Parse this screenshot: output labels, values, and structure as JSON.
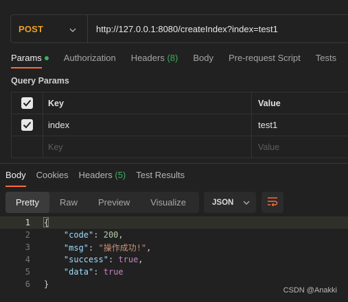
{
  "request": {
    "method": "POST",
    "url": "http://127.0.0.1:8080/createIndex?index=test1"
  },
  "request_tabs": [
    {
      "label": "Params",
      "active": true
    },
    {
      "label": "Authorization"
    },
    {
      "label": "Headers",
      "count": "(8)"
    },
    {
      "label": "Body"
    },
    {
      "label": "Pre-request Script"
    },
    {
      "label": "Tests"
    }
  ],
  "query_params": {
    "title": "Query Params",
    "header": {
      "key": "Key",
      "value": "Value"
    },
    "rows": [
      {
        "checked": true,
        "key": "index",
        "value": "test1"
      }
    ],
    "placeholder": {
      "key": "Key",
      "value": "Value"
    }
  },
  "response_tabs": [
    {
      "label": "Body",
      "active": true
    },
    {
      "label": "Cookies"
    },
    {
      "label": "Headers",
      "count": "(5)"
    },
    {
      "label": "Test Results"
    }
  ],
  "view_modes": [
    {
      "label": "Pretty",
      "active": true
    },
    {
      "label": "Raw"
    },
    {
      "label": "Preview"
    },
    {
      "label": "Visualize"
    }
  ],
  "format": "JSON",
  "response_body": {
    "line_numbers": [
      "1",
      "2",
      "3",
      "4",
      "5",
      "6"
    ],
    "open_brace": "{",
    "close_brace": "}",
    "fields": [
      {
        "key": "\"code\"",
        "value": "200",
        "type": "number"
      },
      {
        "key": "\"msg\"",
        "value": "\"操作成功!\"",
        "type": "string"
      },
      {
        "key": "\"success\"",
        "value": "true",
        "type": "boolean"
      },
      {
        "key": "\"data\"",
        "value": "true",
        "type": "boolean"
      }
    ]
  },
  "watermark": "CSDN @Anakki",
  "colors": {
    "accent": "#ff6c37",
    "method": "#f0a022",
    "success": "#3cb15d"
  }
}
